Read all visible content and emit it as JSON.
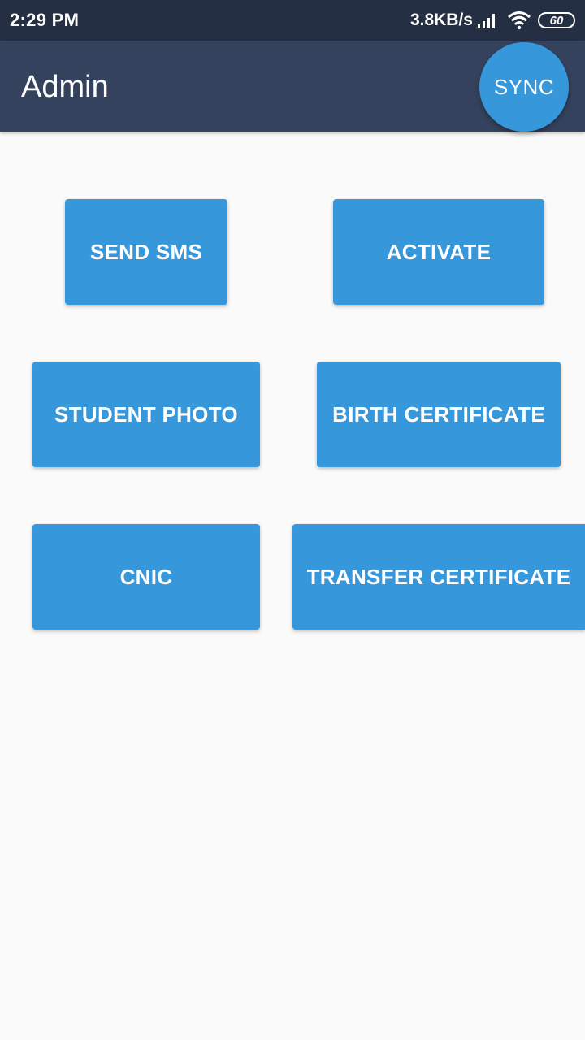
{
  "status_bar": {
    "time": "2:29 PM",
    "net_speed": "3.8KB/s",
    "battery": "60",
    "icons": [
      "signal-icon",
      "wifi-icon",
      "battery-icon"
    ]
  },
  "app_bar": {
    "title": "Admin",
    "sync_label": "SYNC"
  },
  "actions": {
    "send_sms": "SEND SMS",
    "activate": "ACTIVATE",
    "student_photo": "STUDENT PHOTO",
    "birth_certificate": "BIRTH CERTIFICATE",
    "cnic": "CNIC",
    "transfer_certificate": "TRANSFER CERTIFICATE"
  },
  "colors": {
    "status_bar": "#252f43",
    "app_bar": "#34425d",
    "button": "#3797db",
    "background": "#fafafa"
  }
}
